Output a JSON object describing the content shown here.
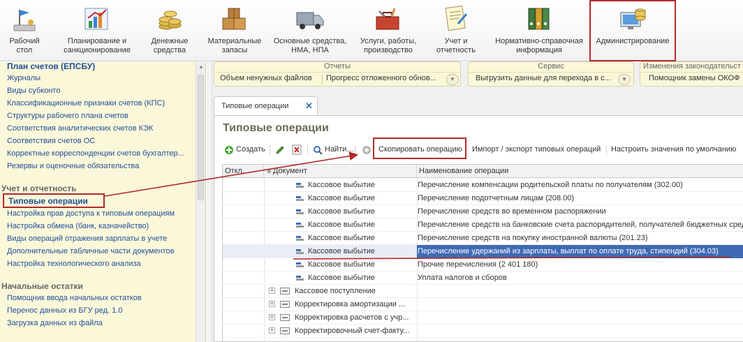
{
  "toolbar": {
    "items": [
      {
        "label": "Рабочий\nстол",
        "icon": "desktop-flag-icon"
      },
      {
        "label": "Планирование и\nсанкционирование",
        "icon": "chart-icon"
      },
      {
        "label": "Денежные\nсредства",
        "icon": "coins-icon"
      },
      {
        "label": "Материальные\nзапасы",
        "icon": "boxes-icon"
      },
      {
        "label": "Основные средства,\nНМА, НПА",
        "icon": "truck-icon"
      },
      {
        "label": "Услуги, работы,\nпроизводство",
        "icon": "toolbox-icon"
      },
      {
        "label": "Учет и\nотчетность",
        "icon": "report-icon"
      },
      {
        "label": "Нормативно-справочная\nинформация",
        "icon": "binders-icon"
      },
      {
        "label": "Администрирование",
        "icon": "admin-computer-icon"
      }
    ]
  },
  "left_panel": {
    "top_heading": "План счетов (ЕПСБУ)",
    "group1": [
      "Журналы",
      "Виды субконто",
      "Классификационные признаки счетов (КПС)",
      "Структуры рабочего плана счетов",
      "Соответствия аналитических счетов КЭК",
      "Соответствия счетов ОС",
      "Корректные корреспонденции счетов бухгалтер...",
      "Резервы и оценочные обязательства"
    ],
    "section_reporting": "Учет и отчетность",
    "selected_item": "Типовые операции",
    "group2": [
      "Настройка прав доступа к типовым операциям",
      "Настройка обмена (банк, казначейство)",
      "Виды операций отражения зарплаты в учете",
      "Дополнительные табличные части документов",
      "Настройка технологического анализа"
    ],
    "section_initial": "Начальные остатки",
    "group3": [
      "Помощник ввода начальных остатков",
      "Перенос данных из БГУ ред. 1.0",
      "Загрузка данных из файла"
    ]
  },
  "groups": {
    "reports": {
      "title": "Отчеты",
      "cmd1": "Объем ненужных файлов",
      "cmd2": "Прогресс отложенного обнов..."
    },
    "service": {
      "title": "Сервис",
      "cmd1": "Выгрузить данные для перехода в с..."
    },
    "law": {
      "title": "Изменения законодательст",
      "cmd1": "Помощник замены ОКОФ"
    }
  },
  "tab": {
    "label": "Типовые операции",
    "close": "✕"
  },
  "form": {
    "title": "Типовые операции",
    "commands": {
      "create": "Создать",
      "find": "Найти...",
      "copy": "Скопировать операцию",
      "import_export": "Импорт / экспорт типовых операций",
      "defaults": "Настроить значения по умолчанию"
    }
  },
  "table": {
    "headers": {
      "off": "Откл.",
      "doc": "Документ",
      "name": "Наименование операции"
    },
    "rows": [
      {
        "doc": "Кассовое выбытие",
        "name": "Перечисление компенсации родительской платы по получателям (302.00)",
        "type": "op"
      },
      {
        "doc": "Кассовое выбытие",
        "name": "Перечисление подотчетным лицам (208.00)",
        "type": "op"
      },
      {
        "doc": "Кассовое выбытие",
        "name": "Перечисление средств во временном распоряжении",
        "type": "op"
      },
      {
        "doc": "Кассовое выбытие",
        "name": "Перечисление средств на банковские счета распорядителей, получателей бюджетных средс",
        "type": "op"
      },
      {
        "doc": "Кассовое выбытие",
        "name": "Перечисление средств на покупку иностранной валюты (201.23)",
        "type": "op"
      },
      {
        "doc": "Кассовое выбытие",
        "name": "Перечисление удержаний из зарплаты, выплат по оплате труда, стипендий (304.03)",
        "type": "op",
        "selected": true
      },
      {
        "doc": "Кассовое выбытие",
        "name": "Прочие перечисления (2 401 180)",
        "type": "op"
      },
      {
        "doc": "Кассовое выбытие",
        "name": "Уплата налогов и сборов",
        "type": "op"
      },
      {
        "doc": "Кассовое поступление",
        "name": "",
        "type": "group"
      },
      {
        "doc": "Корректировка амортизации ...",
        "name": "",
        "type": "group"
      },
      {
        "doc": "Корректировка расчетов с учр...",
        "name": "",
        "type": "group"
      },
      {
        "doc": "Корректировочный счет-факту...",
        "name": "",
        "type": "group"
      }
    ]
  },
  "colors": {
    "highlight": "#b22a2a",
    "link": "#1f4e99",
    "selection": "#3f6ab3",
    "panel": "#fbf7d9"
  }
}
